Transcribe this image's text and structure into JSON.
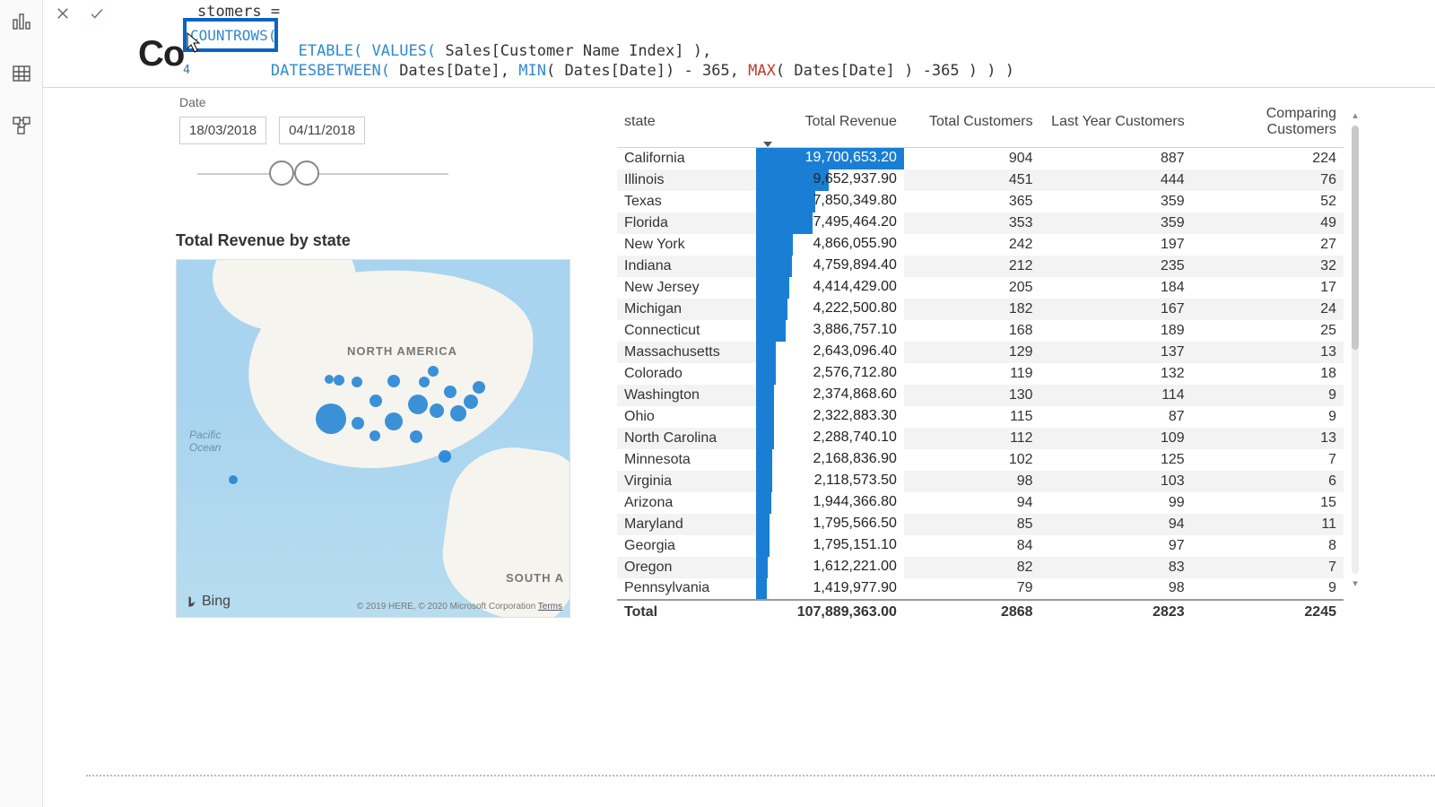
{
  "rail": {
    "tooltips": [
      "Report view",
      "Data view",
      "Model view"
    ]
  },
  "formula": {
    "line1_tail": "stomers =",
    "highlight": "COUNTROWS(",
    "line2_fn": "ETABLE(",
    "line2_fn2": "VALUES(",
    "line2_arg": " Sales[Customer Name Index] ),",
    "lineno4": "4",
    "line3_fn": "DATESBETWEEN(",
    "line3_a": " Dates[Date], ",
    "line3_min": "MIN",
    "line3_b": "( Dates[Date]) - 365, ",
    "line3_max": "MAX",
    "line3_c": "( Dates[Date] ) -365 ) ) )"
  },
  "title_fragment": "Co",
  "slicer": {
    "label": "Date",
    "start": "18/03/2018",
    "end": "04/11/2018"
  },
  "map": {
    "title": "Total Revenue by state",
    "na": "NORTH AMERICA",
    "sa": "SOUTH A",
    "pacific1": "Pacific",
    "pacific2": "Ocean",
    "bing": "Bing",
    "copyright": "© 2019 HERE, © 2020 Microsoft Corporation",
    "terms": "Terms"
  },
  "table": {
    "headers": {
      "state": "state",
      "revenue": "Total Revenue",
      "customers": "Total Customers",
      "last": "Last Year Customers",
      "comparing": "Comparing Customers"
    },
    "rows": [
      {
        "state": "California",
        "rev": "19,700,653.20",
        "bar": 100,
        "cust": "904",
        "last": "887",
        "comp": "224"
      },
      {
        "state": "Illinois",
        "rev": "9,652,937.90",
        "bar": 49,
        "cust": "451",
        "last": "444",
        "comp": "76"
      },
      {
        "state": "Texas",
        "rev": "7,850,349.80",
        "bar": 40,
        "cust": "365",
        "last": "359",
        "comp": "52"
      },
      {
        "state": "Florida",
        "rev": "7,495,464.20",
        "bar": 38,
        "cust": "353",
        "last": "359",
        "comp": "49"
      },
      {
        "state": "New York",
        "rev": "4,866,055.90",
        "bar": 25,
        "cust": "242",
        "last": "197",
        "comp": "27"
      },
      {
        "state": "Indiana",
        "rev": "4,759,894.40",
        "bar": 24,
        "cust": "212",
        "last": "235",
        "comp": "32"
      },
      {
        "state": "New Jersey",
        "rev": "4,414,429.00",
        "bar": 22,
        "cust": "205",
        "last": "184",
        "comp": "17"
      },
      {
        "state": "Michigan",
        "rev": "4,222,500.80",
        "bar": 21,
        "cust": "182",
        "last": "167",
        "comp": "24"
      },
      {
        "state": "Connecticut",
        "rev": "3,886,757.10",
        "bar": 20,
        "cust": "168",
        "last": "189",
        "comp": "25"
      },
      {
        "state": "Massachusetts",
        "rev": "2,643,096.40",
        "bar": 13,
        "cust": "129",
        "last": "137",
        "comp": "13"
      },
      {
        "state": "Colorado",
        "rev": "2,576,712.80",
        "bar": 13,
        "cust": "119",
        "last": "132",
        "comp": "18"
      },
      {
        "state": "Washington",
        "rev": "2,374,868.60",
        "bar": 12,
        "cust": "130",
        "last": "114",
        "comp": "9"
      },
      {
        "state": "Ohio",
        "rev": "2,322,883.30",
        "bar": 12,
        "cust": "115",
        "last": "87",
        "comp": "9"
      },
      {
        "state": "North Carolina",
        "rev": "2,288,740.10",
        "bar": 12,
        "cust": "112",
        "last": "109",
        "comp": "13"
      },
      {
        "state": "Minnesota",
        "rev": "2,168,836.90",
        "bar": 11,
        "cust": "102",
        "last": "125",
        "comp": "7"
      },
      {
        "state": "Virginia",
        "rev": "2,118,573.50",
        "bar": 11,
        "cust": "98",
        "last": "103",
        "comp": "6"
      },
      {
        "state": "Arizona",
        "rev": "1,944,366.80",
        "bar": 10,
        "cust": "94",
        "last": "99",
        "comp": "15"
      },
      {
        "state": "Maryland",
        "rev": "1,795,566.50",
        "bar": 9,
        "cust": "85",
        "last": "94",
        "comp": "11"
      },
      {
        "state": "Georgia",
        "rev": "1,795,151.10",
        "bar": 9,
        "cust": "84",
        "last": "97",
        "comp": "8"
      },
      {
        "state": "Oregon",
        "rev": "1,612,221.00",
        "bar": 8,
        "cust": "82",
        "last": "83",
        "comp": "7"
      },
      {
        "state": "Pennsylvania",
        "rev": "1,419,977.90",
        "bar": 7,
        "cust": "79",
        "last": "98",
        "comp": "9"
      }
    ],
    "total": {
      "label": "Total",
      "rev": "107,889,363.00",
      "cust": "2868",
      "last": "2823",
      "comp": "2245"
    }
  }
}
